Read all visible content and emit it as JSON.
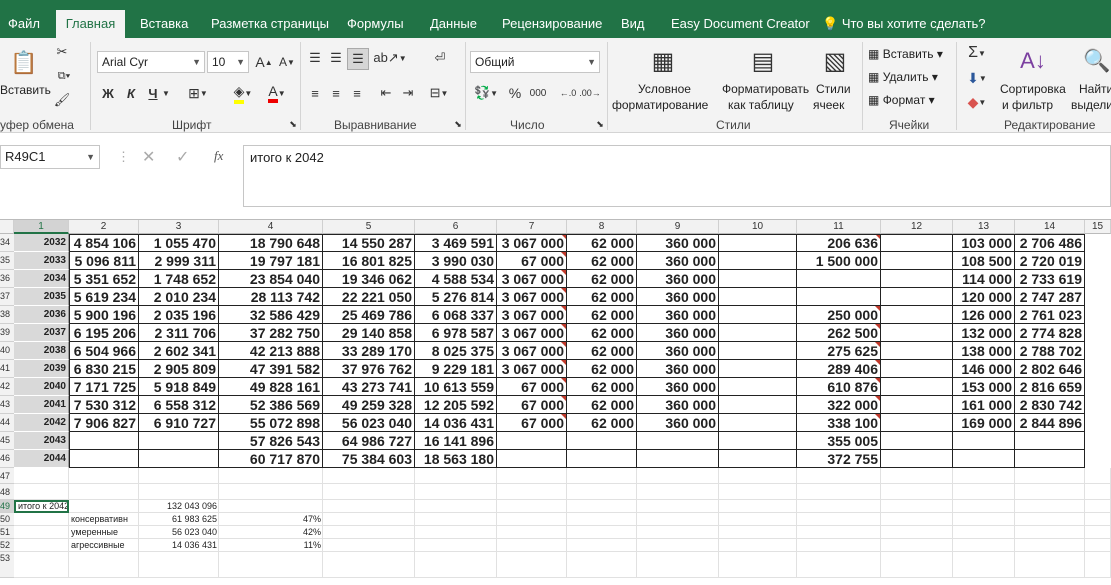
{
  "tabs": [
    "Файл",
    "Главная",
    "Вставка",
    "Разметка страницы",
    "Формулы",
    "Данные",
    "Рецензирование",
    "Вид",
    "Easy Document Creator",
    "Что вы хотите сделать?"
  ],
  "ribbon": {
    "paste": "Вставить",
    "clipboard": "уфер обмена",
    "font_name": "Arial Cyr",
    "font_size": "10",
    "bold": "Ж",
    "italic": "К",
    "underline": "Ч",
    "font_group": "Шрифт",
    "align_group": "Выравнивание",
    "number_format": "Общий",
    "percent": "%",
    "thousands": "000",
    "number_group": "Число",
    "cond_fmt_1": "Условное",
    "cond_fmt_2": "форматирование",
    "fmt_table_1": "Форматировать",
    "fmt_table_2": "как таблицу",
    "styles_1": "Стили",
    "styles_2": "ячеек",
    "styles_group": "Стили",
    "insert": "Вставить",
    "delete": "Удалить",
    "format": "Формат",
    "cells_group": "Ячейки",
    "sort_1": "Сортировка",
    "sort_2": "и фильтр",
    "find_1": "Найти",
    "find_2": "выдели",
    "edit_group": "Редактирование"
  },
  "formula_bar": {
    "name_box": "R49C1",
    "fx": "fx",
    "value": "итого к 2042"
  },
  "columns": [
    "1",
    "2",
    "3",
    "4",
    "5",
    "6",
    "7",
    "8",
    "9",
    "10",
    "11",
    "12",
    "13",
    "14",
    "15"
  ],
  "rows": [
    {
      "n": "34",
      "cells": [
        "2032",
        "4 854 106",
        "1 055 470",
        "18 790 648",
        "14 550 287",
        "3 469 591",
        "3 067 000",
        "62 000",
        "360 000",
        "",
        "206 636",
        "",
        "103 000",
        "2 706 486"
      ]
    },
    {
      "n": "35",
      "cells": [
        "2033",
        "5 096 811",
        "2 999 311",
        "19 797 181",
        "16 801 825",
        "3 990 030",
        "67 000",
        "62 000",
        "360 000",
        "",
        "1 500 000",
        "",
        "108 500",
        "2 720 019"
      ]
    },
    {
      "n": "36",
      "cells": [
        "2034",
        "5 351 652",
        "1 748 652",
        "23 854 040",
        "19 346 062",
        "4 588 534",
        "3 067 000",
        "62 000",
        "360 000",
        "",
        "",
        "",
        "114 000",
        "2 733 619"
      ]
    },
    {
      "n": "37",
      "cells": [
        "2035",
        "5 619 234",
        "2 010 234",
        "28 113 742",
        "22 221 050",
        "5 276 814",
        "3 067 000",
        "62 000",
        "360 000",
        "",
        "",
        "",
        "120 000",
        "2 747 287"
      ]
    },
    {
      "n": "38",
      "cells": [
        "2036",
        "5 900 196",
        "2 035 196",
        "32 586 429",
        "25 469 786",
        "6 068 337",
        "3 067 000",
        "62 000",
        "360 000",
        "",
        "250 000",
        "",
        "126 000",
        "2 761 023"
      ]
    },
    {
      "n": "39",
      "cells": [
        "2037",
        "6 195 206",
        "2 311 706",
        "37 282 750",
        "29 140 858",
        "6 978 587",
        "3 067 000",
        "62 000",
        "360 000",
        "",
        "262 500",
        "",
        "132 000",
        "2 774 828"
      ]
    },
    {
      "n": "40",
      "cells": [
        "2038",
        "6 504 966",
        "2 602 341",
        "42 213 888",
        "33 289 170",
        "8 025 375",
        "3 067 000",
        "62 000",
        "360 000",
        "",
        "275 625",
        "",
        "138 000",
        "2 788 702"
      ]
    },
    {
      "n": "41",
      "cells": [
        "2039",
        "6 830 215",
        "2 905 809",
        "47 391 582",
        "37 976 762",
        "9 229 181",
        "3 067 000",
        "62 000",
        "360 000",
        "",
        "289 406",
        "",
        "146 000",
        "2 802 646"
      ]
    },
    {
      "n": "42",
      "cells": [
        "2040",
        "7 171 725",
        "5 918 849",
        "49 828 161",
        "43 273 741",
        "10 613 559",
        "67 000",
        "62 000",
        "360 000",
        "",
        "610 876",
        "",
        "153 000",
        "2 816 659"
      ]
    },
    {
      "n": "43",
      "cells": [
        "2041",
        "7 530 312",
        "6 558 312",
        "52 386 569",
        "49 259 328",
        "12 205 592",
        "67 000",
        "62 000",
        "360 000",
        "",
        "322 000",
        "",
        "161 000",
        "2 830 742"
      ]
    },
    {
      "n": "44",
      "cells": [
        "2042",
        "7 906 827",
        "6 910 727",
        "55 072 898",
        "56 023 040",
        "14 036 431",
        "67 000",
        "62 000",
        "360 000",
        "",
        "338 100",
        "",
        "169 000",
        "2 844 896"
      ]
    },
    {
      "n": "45",
      "cells": [
        "2043",
        "",
        "",
        "57 826 543",
        "64 986 727",
        "16 141 896",
        "",
        "",
        "",
        "",
        "355 005",
        "",
        "",
        ""
      ]
    },
    {
      "n": "46",
      "cells": [
        "2044",
        "",
        "",
        "60 717 870",
        "75 384 603",
        "18 563 180",
        "",
        "",
        "",
        "",
        "372 755",
        "",
        "",
        ""
      ]
    }
  ],
  "empty_rows": [
    "47",
    "48"
  ],
  "summary": [
    {
      "n": "49",
      "label": "итого к 2042",
      "value": "132 043 096",
      "pct": ""
    },
    {
      "n": "50",
      "label": "консервативн",
      "value": "61 983 625",
      "pct": "47%"
    },
    {
      "n": "51",
      "label": "умеренные",
      "value": "56 023 040",
      "pct": "42%"
    },
    {
      "n": "52",
      "label": "агрессивные",
      "value": "14 036 431",
      "pct": "11%"
    }
  ],
  "trailing_rows": [
    "53"
  ],
  "colors": {
    "excel_green": "#217346",
    "comment_marker": "#c0392b"
  }
}
